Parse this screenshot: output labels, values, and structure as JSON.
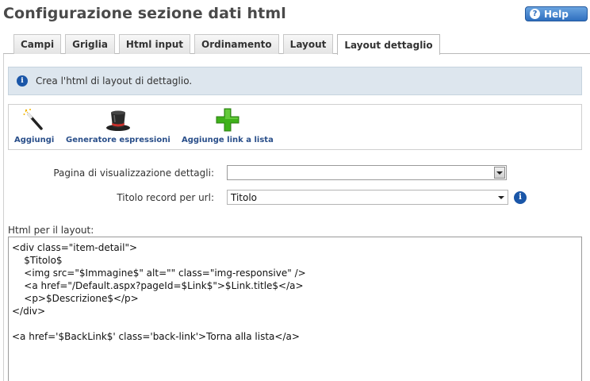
{
  "page": {
    "title": "Configurazione sezione dati html"
  },
  "help": {
    "label": "Help"
  },
  "tabs": [
    {
      "label": "Campi"
    },
    {
      "label": "Griglia"
    },
    {
      "label": "Html input"
    },
    {
      "label": "Ordinamento"
    },
    {
      "label": "Layout"
    },
    {
      "label": "Layout dettaglio"
    }
  ],
  "active_tab": "Layout dettaglio",
  "info": {
    "text": "Crea l'html di layout di dettaglio."
  },
  "toolbar": {
    "add_label": "Aggiungi",
    "expr_label": "Generatore espressioni",
    "link_label": "Aggiunge link a lista"
  },
  "form": {
    "detail_page_label": "Pagina di visualizzazione dettagli:",
    "detail_page_value": "",
    "record_title_label": "Titolo record per url:",
    "record_title_value": "Titolo"
  },
  "html_layout": {
    "label": "Html per il layout:",
    "code": "<div class=\"item-detail\">\n    $Titolo$\n    <img src=\"$Immagine$\" alt=\"\" class=\"img-responsive\" />\n    <a href=\"/Default.aspx?pageId=$Link$\">$Link.title$</a>\n    <p>$Descrizione$</p>\n</div>\n\n<a href='$BackLink$' class='back-link'>Torna alla lista</a>"
  },
  "colors": {
    "accent": "#2f6fbf",
    "link_text": "#2a4f8a",
    "info_bg": "#dde6ee"
  }
}
